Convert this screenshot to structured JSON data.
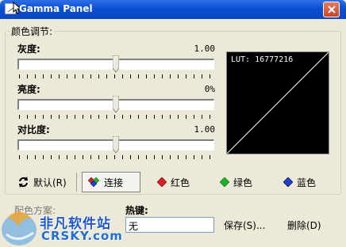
{
  "window": {
    "title": "Gamma Panel"
  },
  "group": {
    "title": "颜色调节:"
  },
  "sliders": [
    {
      "label": "灰度:",
      "value": "1.00",
      "level": 0.5
    },
    {
      "label": "亮度:",
      "value": "0%",
      "level": 0.5
    },
    {
      "label": "对比度:",
      "value": "1.00",
      "level": 0.5
    }
  ],
  "preview": {
    "lut_text": "LUT: 16777216"
  },
  "buttons": {
    "default": "默认(R)",
    "link": "连接",
    "red": "红色",
    "green": "绿色",
    "blue": "蓝色"
  },
  "bottom": {
    "scheme_label": "配色方案:",
    "hotkey_label": "热键:",
    "hotkey_value": "无",
    "save": "保存(S)...",
    "delete": "删除(D)"
  },
  "watermark": {
    "brand": "非凡软件站",
    "url": "CRSKY.com"
  },
  "colors": {
    "title_bar": "#0b4fd2",
    "window_bg": "#ece9d8",
    "red": "#d42020",
    "green": "#22b02c",
    "blue": "#1e3fd0"
  }
}
